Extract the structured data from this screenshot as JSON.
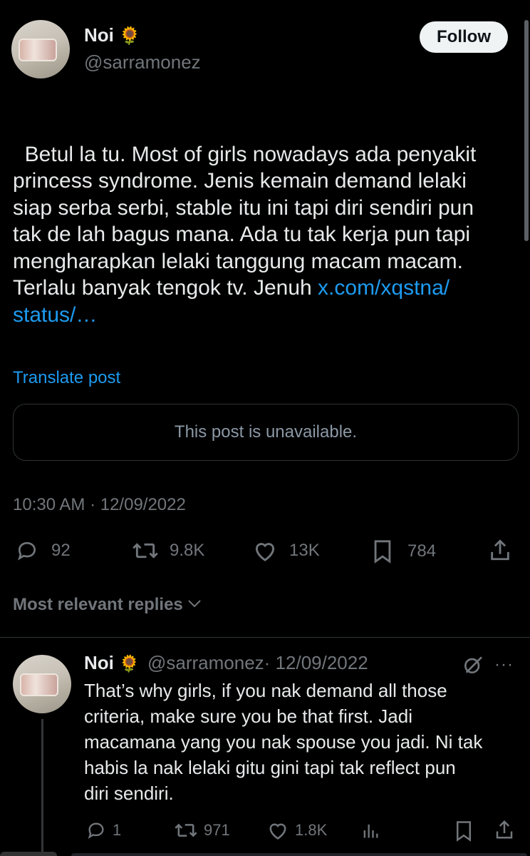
{
  "post": {
    "author_name": "Noi",
    "author_emoji": "🌻",
    "author_handle": "@sarramonez",
    "follow_label": "Follow",
    "text": "Betul la tu. Most of girls nowadays ada penyakit\nprincess syndrome. Jenis kemain demand lelaki\nsiap serba serbi, stable itu ini tapi diri sendiri pun\ntak de lah bagus mana. Ada tu tak kerja pun tapi\nmengharapkan lelaki tanggung macam macam.\nTerlalu banyak tengok tv. Jenuh ",
    "link_text": "x.com/xqstna/\nstatus/…",
    "translate_label": "Translate post",
    "quote_unavailable": "This post is unavailable.",
    "timestamp": "10:30 AM · 12/09/2022",
    "stats": {
      "replies": "92",
      "reposts": "9.8K",
      "likes": "13K",
      "bookmarks": "784"
    }
  },
  "replies_filter_label": "Most relevant replies",
  "reply": {
    "author_name": "Noi",
    "author_emoji": "🌻",
    "author_handle": "@sarramonez",
    "date": "· 12/09/2022",
    "text": "That’s why girls, if you nak demand all those\ncriteria, make sure you be that first. Jadi\nmacamana yang you nak spouse you jadi. Ni tak\nhabis la nak lelaki gitu gini tapi tak reflect pun\ndiri sendiri.",
    "stats": {
      "replies": "1",
      "reposts": "971",
      "likes": "1.8K"
    }
  },
  "colors": {
    "background": "#000000",
    "text": "#e7e9ea",
    "muted": "#71767b",
    "link": "#1d9bf0",
    "border": "#2f3336"
  }
}
